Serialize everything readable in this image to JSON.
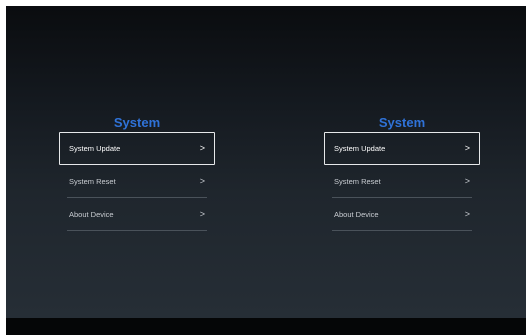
{
  "panels": [
    {
      "title": "System",
      "items": [
        {
          "label": "System Update",
          "chevron": ">"
        },
        {
          "label": "System Reset",
          "chevron": ">"
        },
        {
          "label": "About Device",
          "chevron": ">"
        }
      ]
    },
    {
      "title": "System",
      "items": [
        {
          "label": "System Update",
          "chevron": ">"
        },
        {
          "label": "System Reset",
          "chevron": ">"
        },
        {
          "label": "About Device",
          "chevron": ">"
        }
      ]
    }
  ],
  "colors": {
    "accent": "#2f72d8",
    "text": "#c9cdd2",
    "focus_border": "#e6e8ea",
    "divider": "#4a525a"
  }
}
